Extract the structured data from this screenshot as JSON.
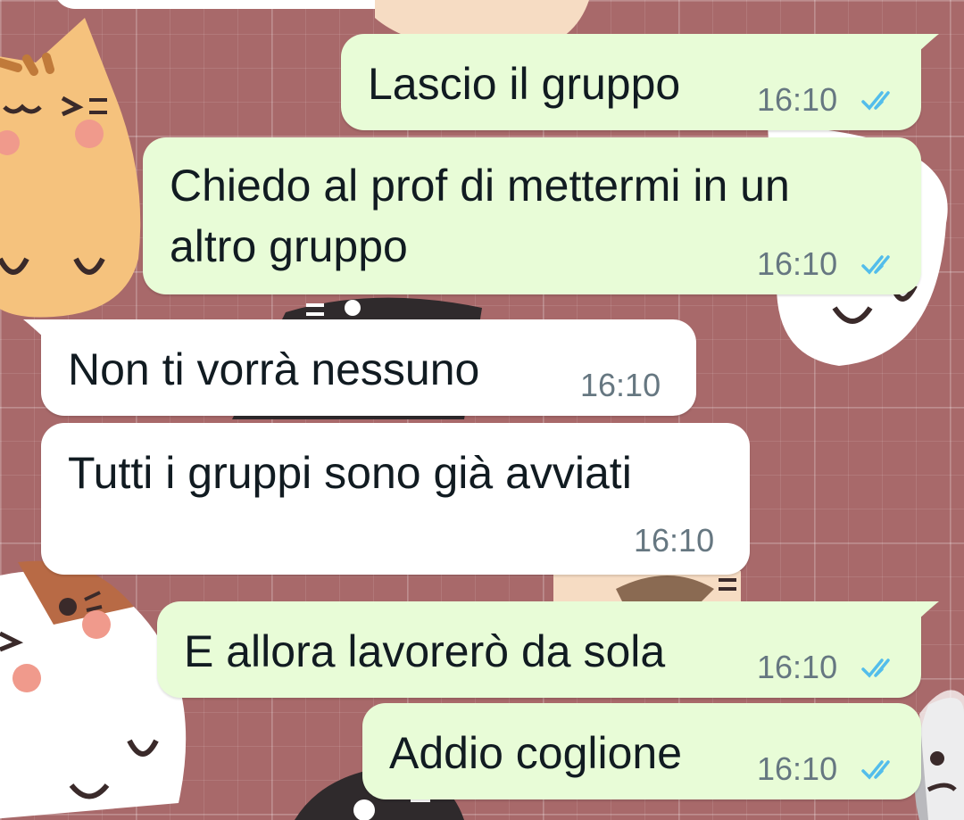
{
  "chat": {
    "messages": [
      {
        "direction": "outgoing",
        "text": "Lascio il gruppo",
        "time": "16:10",
        "status": "read"
      },
      {
        "direction": "outgoing",
        "text_line1": "Chiedo al prof di mettermi in un",
        "text_line2": "altro gruppo",
        "time": "16:10",
        "status": "read"
      },
      {
        "direction": "incoming",
        "text": "Non ti vorrà nessuno",
        "time": "16:10"
      },
      {
        "direction": "incoming",
        "text": "Tutti i gruppi sono già avviati",
        "time": "16:10"
      },
      {
        "direction": "outgoing",
        "text": "E allora lavorerò da sola",
        "time": "16:10",
        "status": "read"
      },
      {
        "direction": "outgoing",
        "text": "Addio coglione",
        "time": "16:10",
        "status": "read"
      }
    ]
  },
  "icons": {
    "read_receipt": "double-check-icon"
  },
  "colors": {
    "wallpaper": "#a8696a",
    "outgoing_bubble": "#e8fcd7",
    "incoming_bubble": "#ffffff",
    "read_ticks": "#53bdeb",
    "meta_text": "#667781"
  }
}
